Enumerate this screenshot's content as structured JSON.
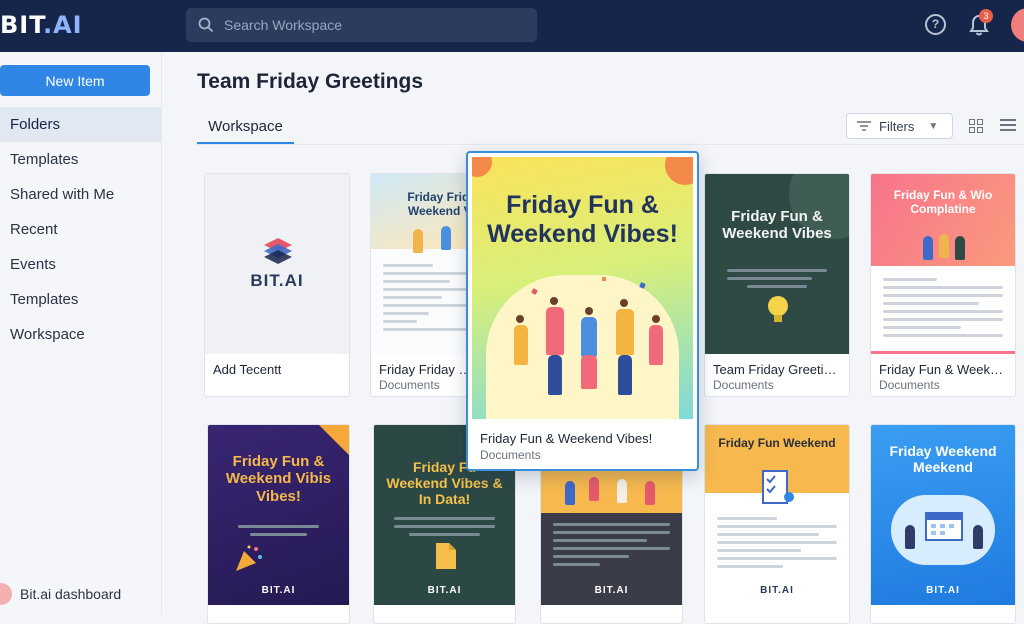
{
  "app": {
    "logo_main": "BIT",
    "logo_dot": ".AI"
  },
  "search": {
    "placeholder": "Search Workspace"
  },
  "header": {
    "notification_count": "3"
  },
  "sidebar": {
    "new_item_label": "New Item",
    "items": [
      {
        "label": "Folders",
        "active": true
      },
      {
        "label": "Templates",
        "active": false
      },
      {
        "label": "Shared with Me",
        "active": false
      },
      {
        "label": "Recent",
        "active": false
      },
      {
        "label": "Events",
        "active": false
      },
      {
        "label": "Templates",
        "active": false
      },
      {
        "label": "Workspace",
        "active": false
      }
    ],
    "dashboard_label": "Bit.ai dashboard"
  },
  "main": {
    "title": "Team Friday Greetings",
    "tab": "Workspace",
    "filters_label": "Filters"
  },
  "cards": [
    {
      "title": "Add Tecentt",
      "subtitle": "",
      "logo_text": "BIT.AI"
    },
    {
      "title": "Friday Friday Gre",
      "subtitle": "Documents",
      "thumb_title": "Friday Friday Weekend Vib"
    },
    {
      "title": "Friday Fun & Weekend Vibes!",
      "subtitle": "Documents",
      "thumb_title": "Friday Fun & Weekend Vibes!"
    },
    {
      "title": "Team  Friday Greeting...",
      "subtitle": "Documents",
      "thumb_title": "Friday Fun & Weekend Vibes"
    },
    {
      "title": "Friday Fun & Weeken...",
      "subtitle": "Documents",
      "thumb_title": "Friday Fun & Wio Complatine"
    },
    {
      "thumb_title": "Friday Fun & Weekend Vibis Vibes!",
      "logo_text": "BIT.AI"
    },
    {
      "thumb_title": "Friday Fu Weekend Vibes & In Data!",
      "logo_text": "BIT.AI"
    },
    {
      "thumb_title": "",
      "logo_text": "BIT.AI"
    },
    {
      "thumb_title": "Friday Fun Weekend",
      "logo_text": "BIT.AI"
    },
    {
      "thumb_title": "Friday Weekend Meekend",
      "logo_text": "BIT.AI"
    }
  ],
  "colors": {
    "topbar": "#16264a",
    "accent": "#3086e4",
    "selected_border": "#3a8ed8"
  }
}
